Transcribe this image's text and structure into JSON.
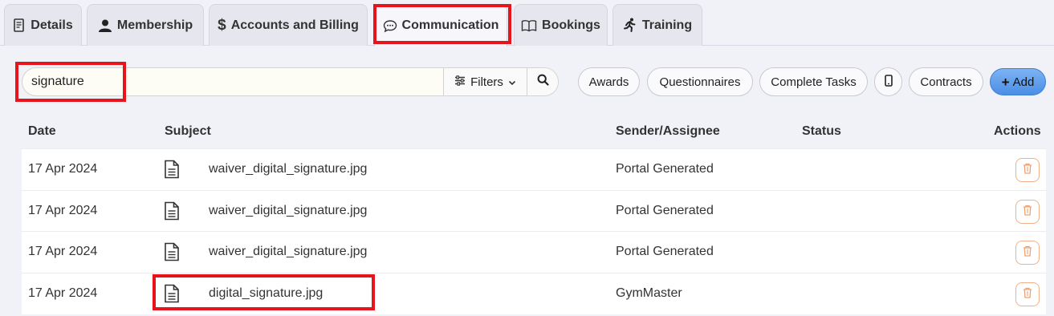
{
  "tabs": [
    {
      "label": "Details",
      "icon": "document-icon"
    },
    {
      "label": "Membership",
      "icon": "user-icon"
    },
    {
      "label": "Accounts and Billing",
      "icon": "dollar-icon"
    },
    {
      "label": "Communication",
      "icon": "chat-bubble-icon",
      "active": true
    },
    {
      "label": "Bookings",
      "icon": "book-icon"
    },
    {
      "label": "Training",
      "icon": "running-person-icon"
    }
  ],
  "search": {
    "value": "signature",
    "filters_label": "Filters"
  },
  "actions": {
    "awards": "Awards",
    "questionnaires": "Questionnaires",
    "complete_tasks": "Complete Tasks",
    "contracts": "Contracts",
    "add": "Add"
  },
  "table": {
    "headers": {
      "date": "Date",
      "subject": "Subject",
      "sender": "Sender/Assignee",
      "status": "Status",
      "actions": "Actions"
    },
    "rows": [
      {
        "date": "17 Apr 2024",
        "subject": "waiver_digital_signature.jpg",
        "sender": "Portal Generated",
        "status": ""
      },
      {
        "date": "17 Apr 2024",
        "subject": "waiver_digital_signature.jpg",
        "sender": "Portal Generated",
        "status": ""
      },
      {
        "date": "17 Apr 2024",
        "subject": "waiver_digital_signature.jpg",
        "sender": "Portal Generated",
        "status": ""
      },
      {
        "date": "17 Apr 2024",
        "subject": "digital_signature.jpg",
        "sender": "GymMaster",
        "status": ""
      }
    ]
  },
  "colors": {
    "highlight": "#e8141b",
    "add_button": "#4a8ee6",
    "trash_accent": "#f0a070"
  }
}
